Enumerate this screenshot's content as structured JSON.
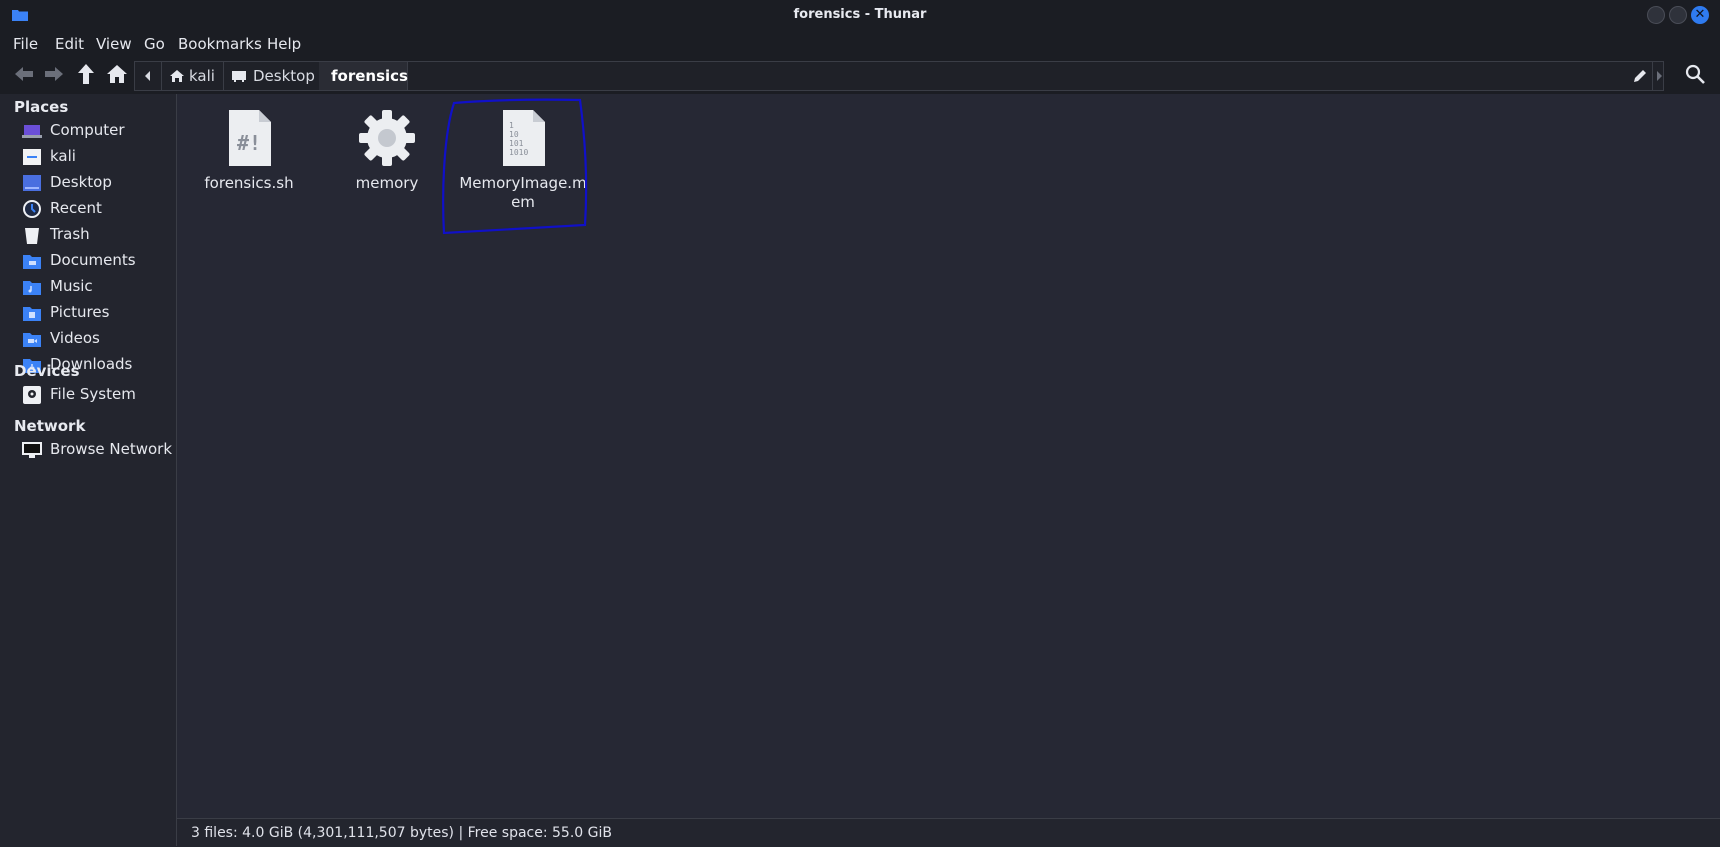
{
  "window": {
    "title": "forensics - Thunar"
  },
  "menu": [
    "File",
    "Edit",
    "View",
    "Go",
    "Bookmarks",
    "Help"
  ],
  "pathbar": {
    "segments": [
      "kali",
      "Desktop",
      "forensics"
    ]
  },
  "sidebar": {
    "places_heading": "Places",
    "places": [
      {
        "label": "Computer",
        "icon": "computer-icon"
      },
      {
        "label": "kali",
        "icon": "home-folder-icon"
      },
      {
        "label": "Desktop",
        "icon": "desktop-icon"
      },
      {
        "label": "Recent",
        "icon": "recent-icon"
      },
      {
        "label": "Trash",
        "icon": "trash-icon"
      },
      {
        "label": "Documents",
        "icon": "documents-folder-icon"
      },
      {
        "label": "Music",
        "icon": "music-folder-icon"
      },
      {
        "label": "Pictures",
        "icon": "pictures-folder-icon"
      },
      {
        "label": "Videos",
        "icon": "videos-folder-icon"
      },
      {
        "label": "Downloads",
        "icon": "downloads-folder-icon"
      }
    ],
    "devices_heading": "Devices",
    "devices": [
      {
        "label": "File System",
        "icon": "drive-icon"
      }
    ],
    "network_heading": "Network",
    "network": [
      {
        "label": "Browse Network",
        "icon": "network-icon"
      }
    ]
  },
  "files": [
    {
      "name": "forensics.sh",
      "icon": "script-file-icon",
      "glyph": "#!"
    },
    {
      "name": "memory",
      "icon": "gear-icon"
    },
    {
      "name": "MemoryImage.mem",
      "icon": "binary-file-icon",
      "glyph": "1\n10\n101\n1010"
    }
  ],
  "status": {
    "text": "3 files: 4.0 GiB (4,301,111,507 bytes) | Free space: 55.0 GiB"
  },
  "colors": {
    "accent": "#2f7bf0",
    "background": "#262834",
    "highlight_stroke": "#1010c8"
  }
}
